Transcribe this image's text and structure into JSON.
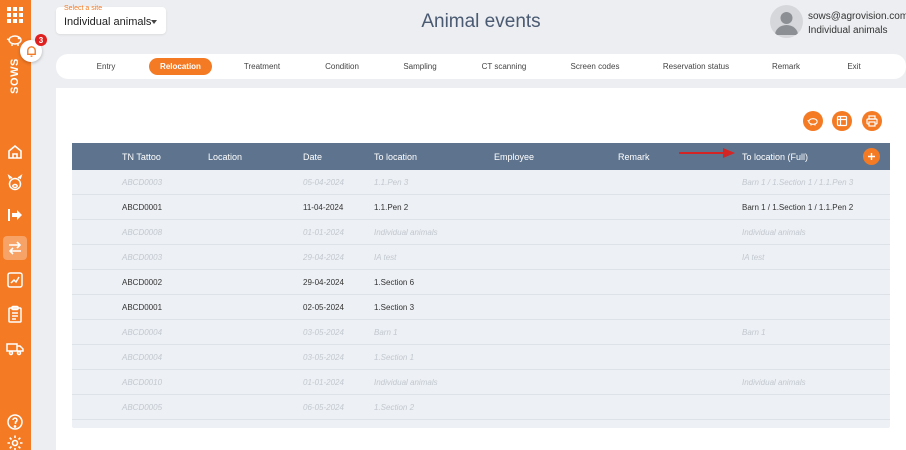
{
  "sidebar": {
    "brand": "SOWS",
    "notification_count": "3"
  },
  "site_select": {
    "label": "Select a site",
    "value": "Individual animals"
  },
  "page_title": "Animal events",
  "user": {
    "email": "sows@agrovision.com",
    "site": "Individual animals"
  },
  "tabs": [
    {
      "label": "Entry",
      "active": false
    },
    {
      "label": "Relocation",
      "active": true
    },
    {
      "label": "Treatment",
      "active": false
    },
    {
      "label": "Condition",
      "active": false
    },
    {
      "label": "Sampling",
      "active": false
    },
    {
      "label": "CT scanning",
      "active": false
    },
    {
      "label": "Screen codes",
      "active": false
    },
    {
      "label": "Reservation status",
      "active": false
    },
    {
      "label": "Remark",
      "active": false
    },
    {
      "label": "Exit",
      "active": false
    }
  ],
  "table": {
    "columns": [
      "TN Tattoo",
      "Location",
      "Date",
      "To location",
      "Employee",
      "Remark",
      "To location (Full)"
    ],
    "rows": [
      {
        "dim": true,
        "cells": [
          "ABCD0003",
          "",
          "05-04-2024",
          "1.1.Pen 3",
          "",
          "",
          "Barn 1 / 1.Section 1 / 1.1.Pen 3"
        ]
      },
      {
        "dim": false,
        "cells": [
          "ABCD0001",
          "",
          "11-04-2024",
          "1.1.Pen 2",
          "",
          "",
          "Barn 1 / 1.Section 1 / 1.1.Pen 2"
        ]
      },
      {
        "dim": true,
        "cells": [
          "ABCD0008",
          "",
          "01-01-2024",
          "Individual animals",
          "",
          "",
          "Individual animals"
        ]
      },
      {
        "dim": true,
        "cells": [
          "ABCD0003",
          "",
          "29-04-2024",
          "IA test",
          "",
          "",
          "IA test"
        ]
      },
      {
        "dim": false,
        "cells": [
          "ABCD0002",
          "",
          "29-04-2024",
          "1.Section 6",
          "",
          "",
          ""
        ]
      },
      {
        "dim": false,
        "cells": [
          "ABCD0001",
          "",
          "02-05-2024",
          "1.Section 3",
          "",
          "",
          ""
        ]
      },
      {
        "dim": true,
        "cells": [
          "ABCD0004",
          "",
          "03-05-2024",
          "Barn 1",
          "",
          "",
          "Barn 1"
        ]
      },
      {
        "dim": true,
        "cells": [
          "ABCD0004",
          "",
          "03-05-2024",
          "1.Section 1",
          "",
          "",
          ""
        ]
      },
      {
        "dim": true,
        "cells": [
          "ABCD0010",
          "",
          "01-01-2024",
          "Individual animals",
          "",
          "",
          "Individual animals"
        ]
      },
      {
        "dim": true,
        "cells": [
          "ABCD0005",
          "",
          "06-05-2024",
          "1.Section 2",
          "",
          "",
          ""
        ]
      }
    ]
  },
  "colors": {
    "accent": "#f47a24",
    "header": "#5e748e",
    "title": "#4a5a72",
    "arrow": "#d42424"
  }
}
